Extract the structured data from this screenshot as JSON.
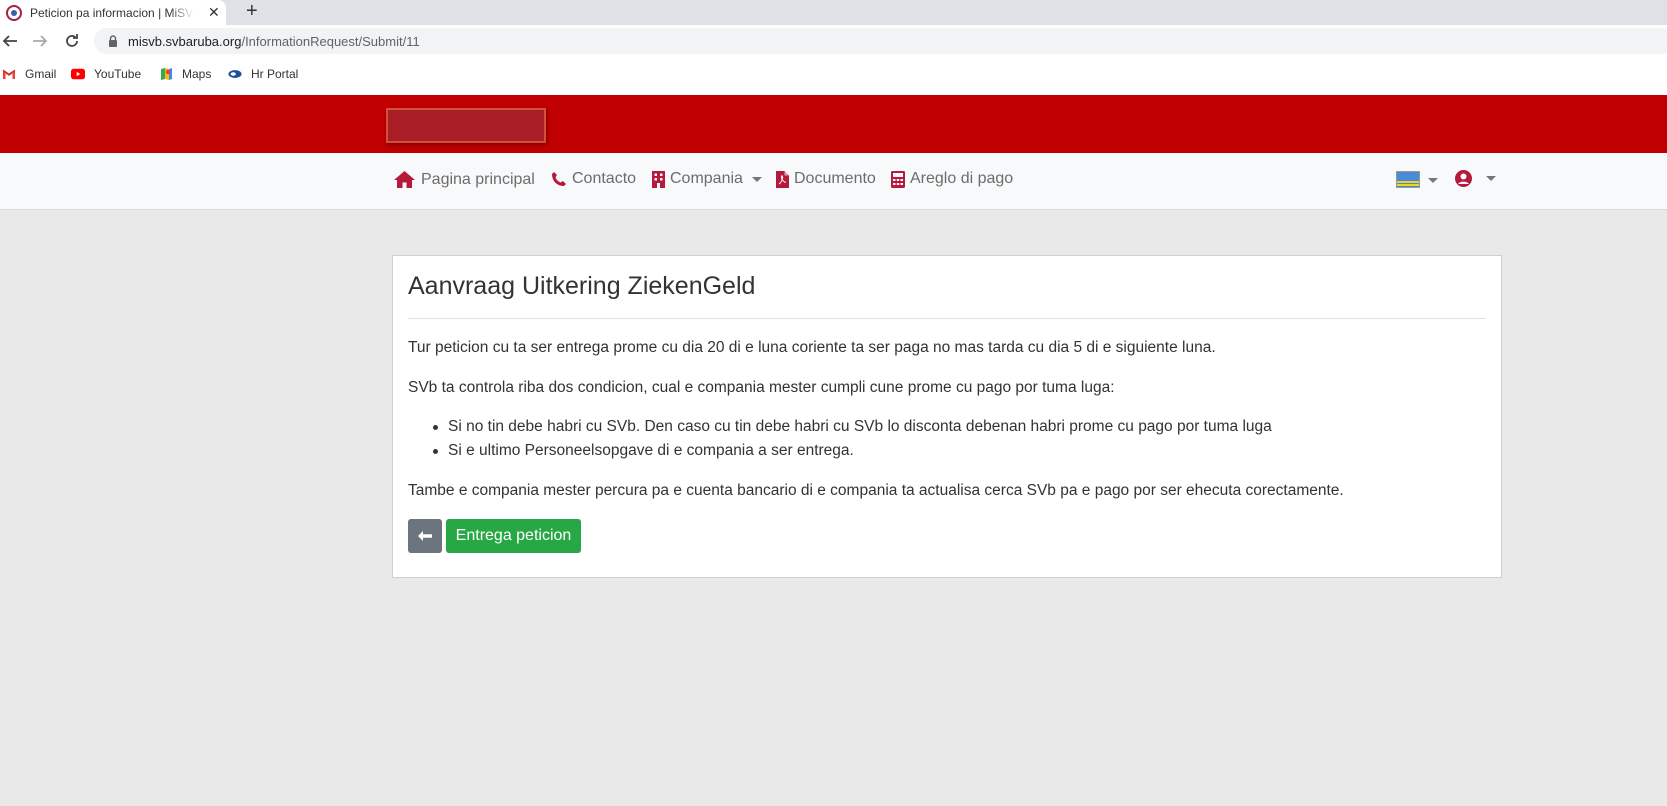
{
  "browser": {
    "tab_title": "Peticion pa informacion | MiSVb",
    "close_symbol": "✕",
    "new_tab_symbol": "+",
    "url_host": "misvb.svbaruba.org",
    "url_path": "/InformationRequest/Submit/11",
    "bookmarks": [
      {
        "label": "Gmail",
        "icon": "gmail-icon"
      },
      {
        "label": "YouTube",
        "icon": "youtube-icon"
      },
      {
        "label": "Maps",
        "icon": "maps-icon"
      },
      {
        "label": "Hr Portal",
        "icon": "hr-portal-icon"
      }
    ]
  },
  "colors": {
    "brand_red": "#c00000",
    "nav_icon": "#b5193c",
    "success": "#28a745",
    "secondary": "#6c757d"
  },
  "nav": {
    "items": [
      {
        "label": "Pagina principal",
        "icon": "home-icon"
      },
      {
        "label": "Contacto",
        "icon": "phone-icon"
      },
      {
        "label": "Compania",
        "icon": "building-icon"
      },
      {
        "label": "Documento",
        "icon": "pdf-file-icon"
      },
      {
        "label": "Areglo di pago",
        "icon": "calculator-icon"
      }
    ],
    "language_icon": "aruba-flag-icon",
    "user_icon": "user-circle-icon"
  },
  "card": {
    "title": "Aanvraag Uitkering ZiekenGeld",
    "p1": "Tur peticion cu ta ser entrega prome cu dia 20 di e luna coriente ta ser paga no mas tarda cu dia 5 di e siguiente luna.",
    "p2": "SVb ta controla riba dos condicion, cual e compania mester cumpli cune prome cu pago por tuma luga:",
    "bullets": [
      "Si no tin debe habri cu SVb. Den caso cu tin debe habri cu SVb lo disconta debenan habri prome cu pago por tuma luga",
      "Si e ultimo Personeelsopgave di e compania a ser entrega."
    ],
    "p3": "Tambe e compania mester percura pa e cuenta bancario di e compania ta actualisa cerca SVb pa e pago por ser ehecuta corectamente.",
    "back_icon": "arrow-left-icon",
    "submit_label": "Entrega peticion"
  }
}
